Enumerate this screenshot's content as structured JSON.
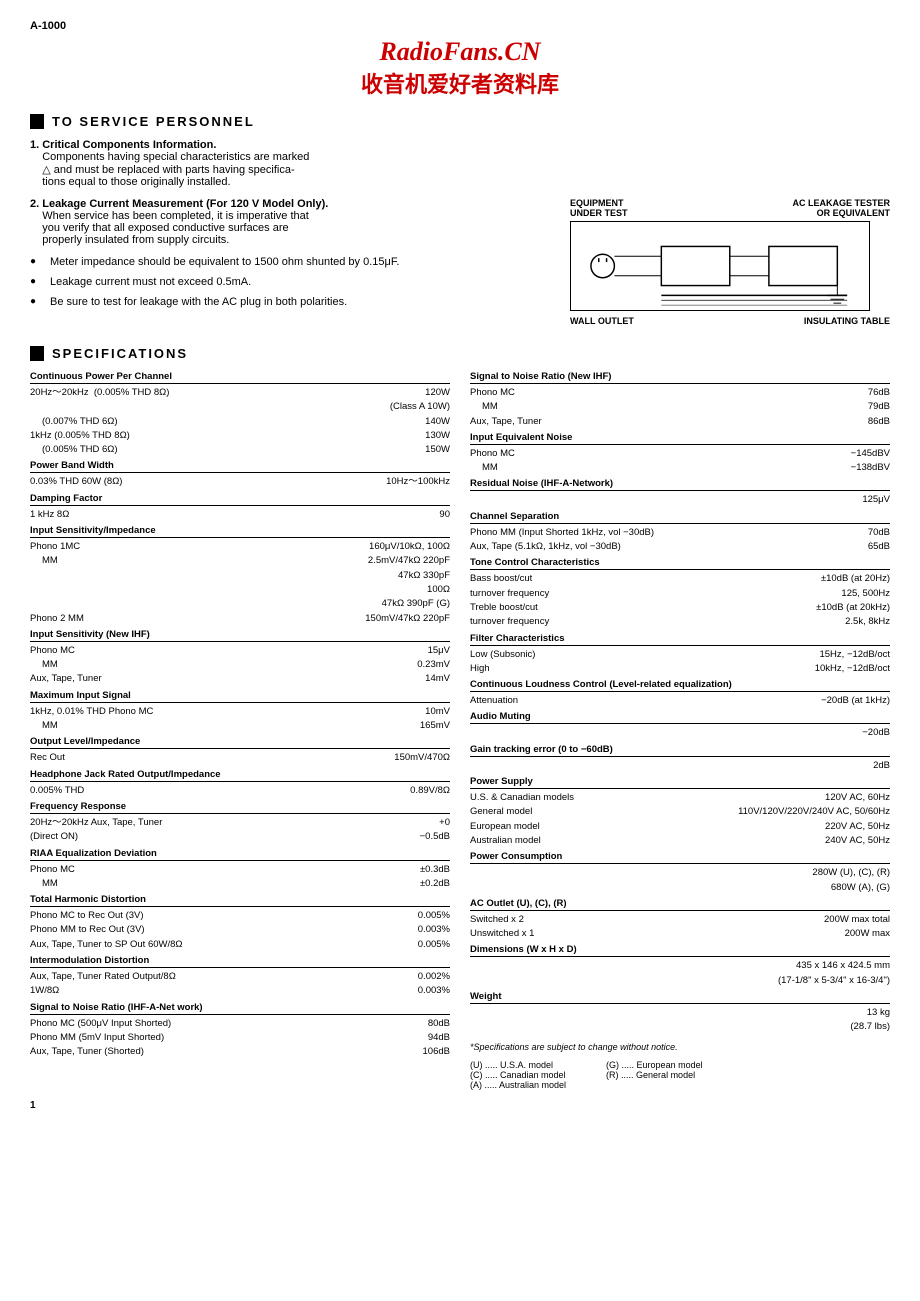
{
  "model": "A-1000",
  "header": {
    "title": "RadioFans.CN",
    "subtitle": "收音机爱好者资料库"
  },
  "service_section": {
    "title": "TO SERVICE PERSONNEL",
    "items": [
      {
        "number": "1",
        "title": "Critical Components Information.",
        "body": "Components having special characteristics are marked △ and must be replaced with parts having specifications equal to those originally installed."
      },
      {
        "number": "2",
        "title": "Leakage Current Measurement (For 120 V Model Only).",
        "body": "When service has been completed, it is imperative that you verify that all exposed conductive surfaces are properly insulated from supply circuits."
      }
    ],
    "bullets": [
      "Meter impedance should be equivalent to 1500 ohm shunted by 0.15μF.",
      "Leakage current must not exceed 0.5mA.",
      "Be sure to test for leakage with the AC plug in both polarities."
    ]
  },
  "diagram": {
    "label1": "EQUIPMENT",
    "label2": "UNDER TEST",
    "label3": "AC LEAKAGE TESTER",
    "label4": "OR EQUIVALENT",
    "wall_outlet": "WALL OUTLET",
    "insulating_table": "INSULATING TABLE"
  },
  "specifications": {
    "title": "SPECIFICATIONS",
    "left_col": [
      {
        "group": "Continuous Power Per Channel",
        "rows": [
          {
            "label": "20Hz～20kHz  (0.005% THD 8Ω)",
            "value": "120W"
          },
          {
            "label": "",
            "value": "(Class A 10W)"
          },
          {
            "label": "(0.007% THD 6Ω)",
            "value": "140W"
          },
          {
            "label": "1kHz (0.005% THD 8Ω)",
            "value": "130W"
          },
          {
            "label": "(0.005% THD 6Ω)",
            "value": "150W"
          }
        ]
      },
      {
        "group": "Power Band Width",
        "rows": [
          {
            "label": "0.03% THD 60W (8Ω)",
            "value": "10Hz～100kHz"
          }
        ]
      },
      {
        "group": "Damping Factor",
        "rows": [
          {
            "label": "1 kHz 8Ω",
            "value": "90"
          }
        ]
      },
      {
        "group": "Input Sensitivity/Impedance",
        "rows": [
          {
            "label": "Phono 1MC",
            "value": "160μV/10kΩ, 100Ω"
          },
          {
            "label": "MM",
            "value": "2.5mV/47kΩ 220pF"
          },
          {
            "label": "",
            "value": "47kΩ 330pF"
          },
          {
            "label": "",
            "value": "100Ω"
          },
          {
            "label": "",
            "value": "47kΩ 390pF (G)"
          },
          {
            "label": "Phono 2 MM",
            "value": "150mV/47kΩ 220pF"
          }
        ]
      },
      {
        "group": "Input Sensitivity (New IHF)",
        "rows": [
          {
            "label": "Phono MC",
            "value": "15μV"
          },
          {
            "label": "MM",
            "value": "0.23mV"
          },
          {
            "label": "Aux, Tape, Tuner",
            "value": "14mV"
          }
        ]
      },
      {
        "group": "Maximum Input Signal",
        "rows": [
          {
            "label": "1kHz, 0.01% THD Phono MC",
            "value": "10mV"
          },
          {
            "label": "MM",
            "value": "165mV"
          }
        ]
      },
      {
        "group": "Output Level/Impedance",
        "rows": [
          {
            "label": "Rec Out",
            "value": "150mV/470Ω"
          }
        ]
      },
      {
        "group": "Headphone Jack Rated Output/Impedance",
        "rows": [
          {
            "label": "0.005% THD",
            "value": "0.89V/8Ω"
          }
        ]
      },
      {
        "group": "Frequency Response",
        "rows": [
          {
            "label": "20Hz～20kHz Aux, Tape, Tuner",
            "value": "+0"
          },
          {
            "label": "(Direct ON)",
            "value": "−0.5dB"
          }
        ]
      },
      {
        "group": "RIAA Equalization Deviation",
        "rows": [
          {
            "label": "Phono MC",
            "value": "±0.3dB"
          },
          {
            "label": "MM",
            "value": "±0.2dB"
          }
        ]
      },
      {
        "group": "Total Harmonic Distortion",
        "rows": [
          {
            "label": "Phono MC to Rec Out (3V)",
            "value": "0.005%"
          },
          {
            "label": "Phono MM to Rec Out (3V)",
            "value": "0.003%"
          },
          {
            "label": "Aux, Tape, Tuner to SP Out 60W/8Ω",
            "value": "0.005%"
          }
        ]
      },
      {
        "group": "Intermodulation Distortion",
        "rows": [
          {
            "label": "Aux, Tape, Tuner Rated Output/8Ω",
            "value": "0.002%"
          },
          {
            "label": "1W/8Ω",
            "value": "0.003%"
          }
        ]
      },
      {
        "group": "Signal to Noise Ratio (IHF-A-Net work)",
        "rows": [
          {
            "label": "Phono MC (500μV Input Shorted)",
            "value": "80dB"
          },
          {
            "label": "Phono MM (5mV Input Shorted)",
            "value": "94dB"
          },
          {
            "label": "Aux, Tape, Tuner (Shorted)",
            "value": "106dB"
          }
        ]
      }
    ],
    "right_col": [
      {
        "group": "Signal to Noise Ratio (New IHF)",
        "rows": [
          {
            "label": "Phono MC",
            "value": "76dB"
          },
          {
            "label": "MM",
            "value": "79dB"
          },
          {
            "label": "Aux, Tape, Tuner",
            "value": "86dB"
          }
        ]
      },
      {
        "group": "Input Equivalent Noise",
        "rows": [
          {
            "label": "Phono MC",
            "value": "−145dBV"
          },
          {
            "label": "MM",
            "value": "−138dBV"
          }
        ]
      },
      {
        "group": "Residual Noise (IHF-A-Network)",
        "rows": [
          {
            "label": "",
            "value": "125μV"
          }
        ]
      },
      {
        "group": "Channel Separation",
        "rows": [
          {
            "label": "Phono MM (Input Shorted 1kHz, vol −30dB)",
            "value": "70dB"
          },
          {
            "label": "Aux, Tape (5.1kΩ, 1kHz, vol −30dB)",
            "value": "65dB"
          }
        ]
      },
      {
        "group": "Tone Control Characteristics",
        "rows": [
          {
            "label": "Bass boost/cut",
            "value": "±10dB (at 20Hz)"
          },
          {
            "label": "turnover frequency",
            "value": "125, 500Hz"
          },
          {
            "label": "Treble boost/cut",
            "value": "±10dB (at 20kHz)"
          },
          {
            "label": "turnover frequency",
            "value": "2.5k, 8kHz"
          }
        ]
      },
      {
        "group": "Filter Characteristics",
        "rows": [
          {
            "label": "Low (Subsonic)",
            "value": "15Hz, −12dB/oct"
          },
          {
            "label": "High",
            "value": "10kHz, −12dB/oct"
          }
        ]
      },
      {
        "group": "Continuous Loudness Control (Level-related equalization)",
        "rows": [
          {
            "label": "Attenuation",
            "value": "−20dB (at 1kHz)"
          }
        ]
      },
      {
        "group": "Audio Muting",
        "rows": [
          {
            "label": "",
            "value": "−20dB"
          }
        ]
      },
      {
        "group": "Gain tracking error (0 to −60dB)",
        "rows": [
          {
            "label": "",
            "value": "2dB"
          }
        ]
      },
      {
        "group": "Power Supply",
        "rows": [
          {
            "label": "U.S. & Canadian models",
            "value": "120V AC, 60Hz"
          },
          {
            "label": "General model",
            "value": "110V/120V/220V/240V AC, 50/60Hz"
          },
          {
            "label": "European model",
            "value": "220V AC, 50Hz"
          },
          {
            "label": "Australian model",
            "value": "240V AC, 50Hz"
          }
        ]
      },
      {
        "group": "Power Consumption",
        "rows": [
          {
            "label": "",
            "value": "280W (U), (C), (R)"
          },
          {
            "label": "",
            "value": "680W (A), (G)"
          }
        ]
      },
      {
        "group": "AC Outlet (U), (C), (R)",
        "rows": [
          {
            "label": "Switched x 2",
            "value": "200W max total"
          },
          {
            "label": "Unswitched x 1",
            "value": "200W max"
          }
        ]
      },
      {
        "group": "Dimensions (W x H x D)",
        "rows": [
          {
            "label": "",
            "value": "435 x 146 x 424.5 mm"
          },
          {
            "label": "",
            "value": "(17-1/8\" x 5-3/4\" x 16-3/4\")"
          }
        ]
      },
      {
        "group": "Weight",
        "rows": [
          {
            "label": "",
            "value": "13 kg"
          },
          {
            "label": "",
            "value": "(28.7 lbs)"
          }
        ]
      }
    ],
    "footer_note": "*Specifications are subject to change without notice.",
    "model_codes": [
      "(U) ..... U.S.A. model",
      "(C) ..... Canadian model",
      "(A) ..... Australian model",
      "(G) ..... European model",
      "(R) ..... General model"
    ]
  },
  "page_number": "1"
}
